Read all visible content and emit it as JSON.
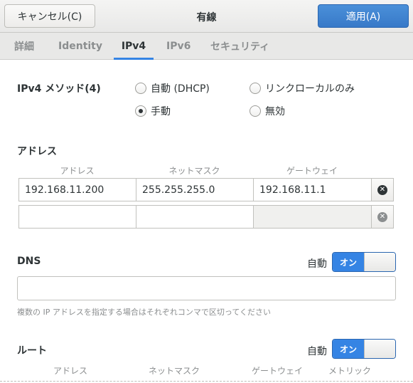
{
  "header": {
    "cancel_label": "キャンセル(C)",
    "title": "有線",
    "apply_label": "適用(A)"
  },
  "tabs": [
    {
      "label": "詳細"
    },
    {
      "label": "Identity"
    },
    {
      "label": "IPv4"
    },
    {
      "label": "IPv6"
    },
    {
      "label": "セキュリティ"
    }
  ],
  "active_tab": "IPv4",
  "ipv4": {
    "method_label": "IPv4 メソッド(4)",
    "methods": [
      {
        "label": "自動 (DHCP)",
        "checked": false
      },
      {
        "label": "リンクローカルのみ",
        "checked": false
      },
      {
        "label": "手動",
        "checked": true
      },
      {
        "label": "無効",
        "checked": false
      }
    ]
  },
  "addresses": {
    "section_title": "アドレス",
    "columns": [
      "アドレス",
      "ネットマスク",
      "ゲートウェイ"
    ],
    "rows": [
      [
        "192.168.11.200",
        "255.255.255.0",
        "192.168.11.1"
      ],
      [
        "",
        "",
        ""
      ]
    ]
  },
  "dns": {
    "section_title": "DNS",
    "auto_label": "自動",
    "switch_label": "オン",
    "value": "",
    "hint": "複数の IP アドレスを指定する場合はそれぞれコンマで区切ってください"
  },
  "routes": {
    "section_title": "ルート",
    "auto_label": "自動",
    "switch_label": "オン",
    "columns": [
      "アドレス",
      "ネットマスク",
      "ゲートウェイ",
      "メトリック"
    ]
  },
  "colors": {
    "accent": "#3584e4",
    "apply_button": "#3a7fcf"
  }
}
